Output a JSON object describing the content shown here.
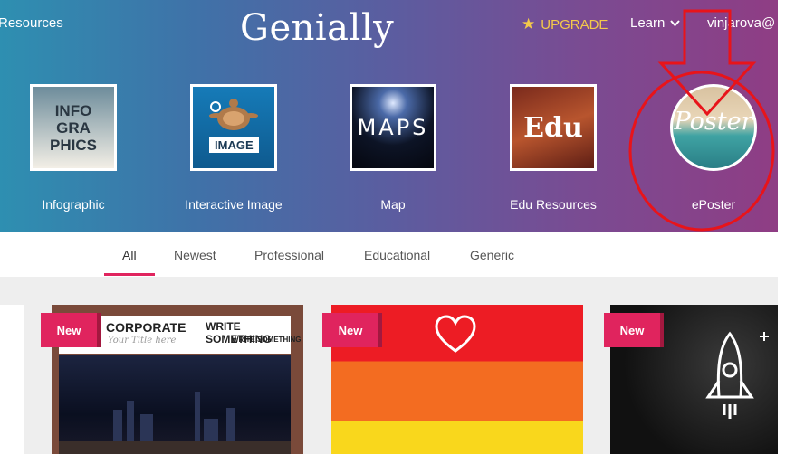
{
  "header": {
    "nav_left": "Resources",
    "logo": "Genially",
    "upgrade": "UPGRADE",
    "learn": "Learn",
    "user": "vinjarova@"
  },
  "categories": [
    {
      "label": "Infographic",
      "thumb_lines": [
        "INFO",
        "GRA",
        "PHICS"
      ]
    },
    {
      "label": "Interactive Image",
      "thumb_text": "IMAGE"
    },
    {
      "label": "Map",
      "thumb_text": "MAPS"
    },
    {
      "label": "Edu Resources",
      "thumb_text": "Edu"
    },
    {
      "label": "ePoster",
      "thumb_text": "Poster"
    }
  ],
  "tabs": [
    {
      "label": "All",
      "active": true
    },
    {
      "label": "Newest"
    },
    {
      "label": "Professional"
    },
    {
      "label": "Educational"
    },
    {
      "label": "Generic"
    }
  ],
  "cards": [
    {
      "badge": "New",
      "title": "CORPORATE",
      "subtitle": "Your Title here",
      "heading": "WRITE SOMETHING",
      "subheading": "WRITE SOMETHING"
    },
    {
      "badge": "New"
    },
    {
      "badge": "New"
    }
  ],
  "colors": {
    "accent": "#e0245e",
    "upgrade": "#f4c94a",
    "annotation": "#e8141a"
  }
}
